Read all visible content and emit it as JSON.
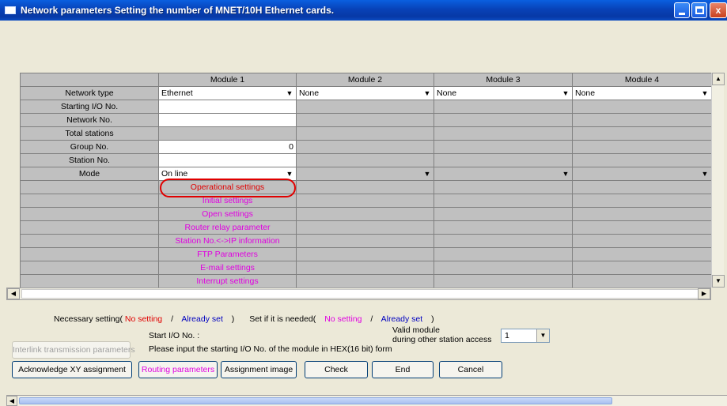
{
  "window": {
    "title": "Network parameters  Setting the number of MNET/10H Ethernet cards.",
    "min_label": "",
    "max_label": "",
    "close_label": "x"
  },
  "grid": {
    "columns": [
      "Module 1",
      "Module 2",
      "Module 3",
      "Module 4"
    ],
    "rows": {
      "network_type": {
        "label": "Network type",
        "values": [
          "Ethernet",
          "None",
          "None",
          "None"
        ]
      },
      "starting_io": {
        "label": "Starting I/O No.",
        "value": ""
      },
      "network_no": {
        "label": "Network No.",
        "value": ""
      },
      "total_stations": {
        "label": "Total stations"
      },
      "group_no": {
        "label": "Group No.",
        "value": "0"
      },
      "station_no": {
        "label": "Station No.",
        "value": ""
      },
      "mode": {
        "label": "Mode",
        "value": "On line"
      }
    },
    "settings_links": [
      "Operational settings",
      "Initial settings",
      "Open settings",
      "Router relay parameter",
      "Station No.<->IP information",
      "FTP Parameters",
      "E-mail settings",
      "Interrupt settings"
    ]
  },
  "legend": {
    "necessary": "Necessary setting(",
    "no_setting": "No setting",
    "slash": "/",
    "already_set": "Already set",
    "close_paren": ")",
    "if_needed": "Set if it is needed(",
    "no_setting2": "No setting",
    "already_set2": "Already set",
    "close_paren2": ")"
  },
  "info": {
    "start_io_label": "Start I/O No. :",
    "instruction": "Please input the starting I/O No. of the module in HEX(16 bit) form",
    "valid_module_line1": "Valid module",
    "valid_module_line2": "during other station access",
    "valid_module_value": "1"
  },
  "buttons": {
    "interlink": "Interlink transmission parameters",
    "acknowledge": "Acknowledge XY assignment",
    "routing": "Routing parameters",
    "assignment": "Assignment image",
    "check": "Check",
    "end": "End",
    "cancel": "Cancel"
  },
  "colors": {
    "title_bar": "#0842b8",
    "required_red": "#e00000",
    "optional_magenta": "#e000e0",
    "already_set_blue": "#0000c0"
  }
}
